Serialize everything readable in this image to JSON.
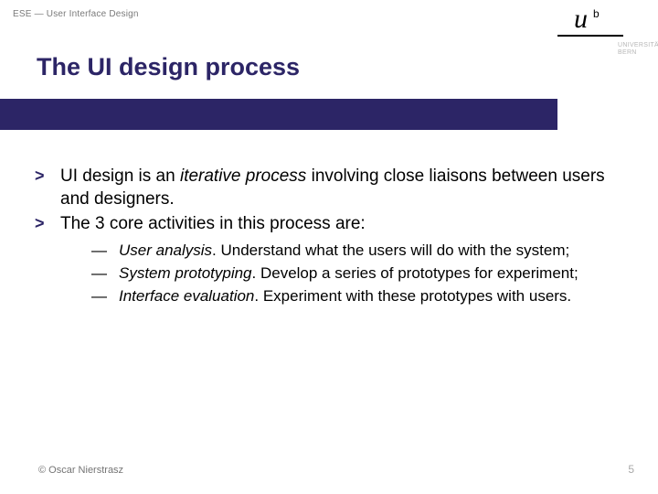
{
  "header": {
    "breadcrumb": "ESE — User Interface Design",
    "title": "The UI design process"
  },
  "logo": {
    "u": "u",
    "b": "b",
    "line1": "UNIVERSITÄT",
    "line2": "BERN"
  },
  "main_points": [
    {
      "bullet": ">",
      "pre": "UI design is an ",
      "em": "iterative process",
      "post": " involving close liaisons between users and designers."
    },
    {
      "bullet": ">",
      "pre": "The 3 core activities in this process are:",
      "em": "",
      "post": ""
    }
  ],
  "sub_points": [
    {
      "dash": "—",
      "em": "User analysis",
      "post": ". Understand what the users will do with the system;"
    },
    {
      "dash": "—",
      "em": "System prototyping",
      "post": ". Develop a series of prototypes for experiment;"
    },
    {
      "dash": "—",
      "em": "Interface evaluation",
      "post": ". Experiment with these prototypes with users."
    }
  ],
  "footer": {
    "copyright": "© Oscar Nierstrasz",
    "page": "5"
  }
}
